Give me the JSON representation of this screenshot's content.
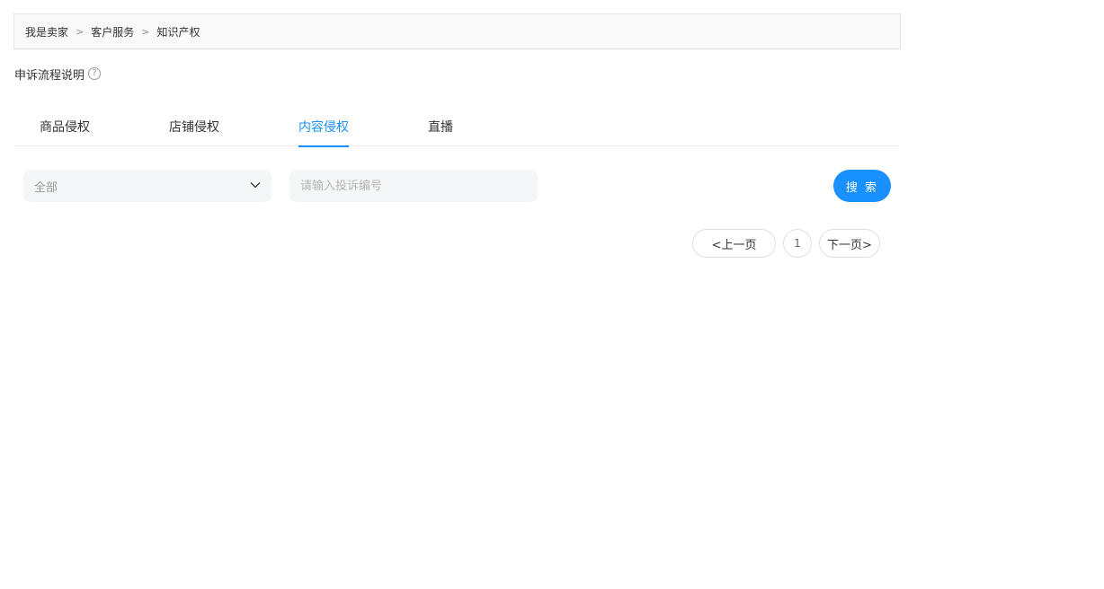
{
  "breadcrumb": {
    "items": [
      "我是卖家",
      "客户服务",
      "知识产权"
    ],
    "separator": ">"
  },
  "process_note": {
    "label": "申诉流程说明",
    "icon": "question-circle-icon",
    "icon_glyph": "?"
  },
  "tabs": [
    {
      "label": "商品侵权",
      "active": false
    },
    {
      "label": "店铺侵权",
      "active": false
    },
    {
      "label": "内容侵权",
      "active": true
    },
    {
      "label": "直播",
      "active": false
    }
  ],
  "filter": {
    "select_value": "全部",
    "select_icon": "chevron-down-icon",
    "input_value": "",
    "input_placeholder": "请输入投诉编号",
    "search_label": "搜 索"
  },
  "pagination": {
    "prev_label": "<上一页",
    "current_page": "1",
    "next_label": "下一页>"
  },
  "colors": {
    "accent": "#1890ff",
    "input_bg": "#f5f6f8",
    "breadcrumb_bg": "#f9f9f9"
  }
}
